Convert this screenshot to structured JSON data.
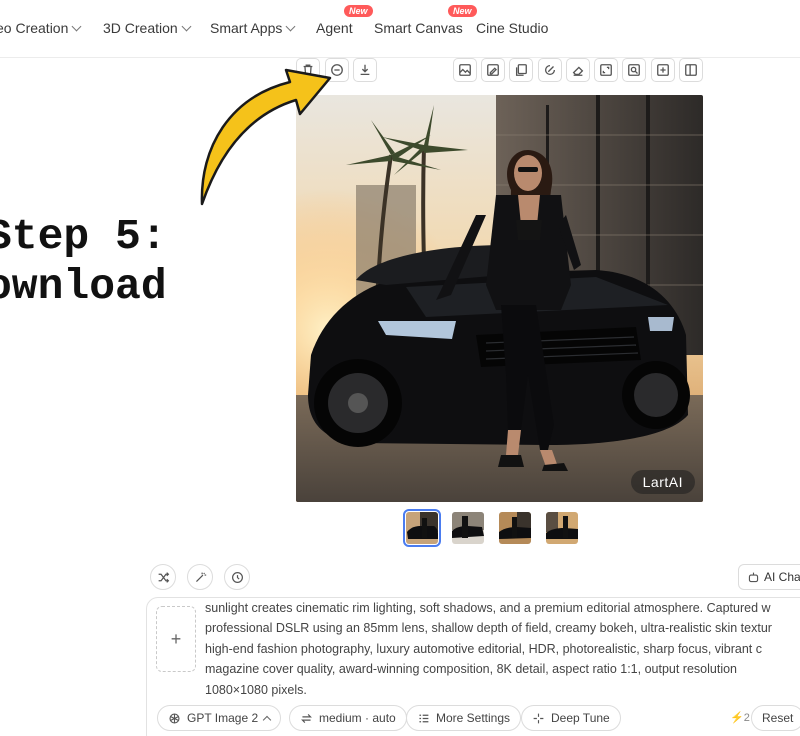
{
  "nav": {
    "items": [
      {
        "label": "eo Creation",
        "has_chevron": true
      },
      {
        "label": "3D Creation",
        "has_chevron": true
      },
      {
        "label": "Smart Apps",
        "has_chevron": true
      },
      {
        "label": "Agent",
        "badge": "New"
      },
      {
        "label": "Smart Canvas",
        "badge": "New"
      },
      {
        "label": "Cine Studio"
      }
    ]
  },
  "image_toolbar_left": [
    "trash-icon",
    "minus-circle-icon",
    "download-icon"
  ],
  "image_toolbar_right": [
    "image-icon",
    "image-edit-icon",
    "copy-icon",
    "magic-edit-icon",
    "eraser-icon",
    "expand-icon",
    "zoom-image-icon",
    "image-add-icon",
    "compare-icon"
  ],
  "main_image": {
    "watermark": "LartAI"
  },
  "thumbnails": {
    "count": 4,
    "active_index": 0
  },
  "overlay": {
    "step_caption": "Step 5:\nownload",
    "arrow_color": "#f5c21a"
  },
  "prompt": {
    "quick_buttons": [
      "shuffle-icon",
      "magic-wand-icon",
      "history-icon"
    ],
    "ai_chat_label": "AI Cha",
    "add_symbol": "+",
    "lines": [
      "sunlight creates cinematic rim lighting, soft shadows, and a premium editorial atmosphere. Captured w",
      "professional DSLR using an 85mm lens, shallow depth of field, creamy bokeh, ultra-realistic skin textur",
      "high-end fashion photography, luxury automotive editorial, HDR, photorealistic, sharp focus, vibrant c",
      "magazine cover quality, award-winning composition, 8K detail, aspect ratio 1:1, output resolution",
      "1080×1080 pixels."
    ]
  },
  "controls": {
    "model": "GPT Image 2",
    "quality": "medium · auto",
    "more_settings": "More Settings",
    "deep_tune": "Deep Tune",
    "credits": "2",
    "reset": "Reset"
  }
}
